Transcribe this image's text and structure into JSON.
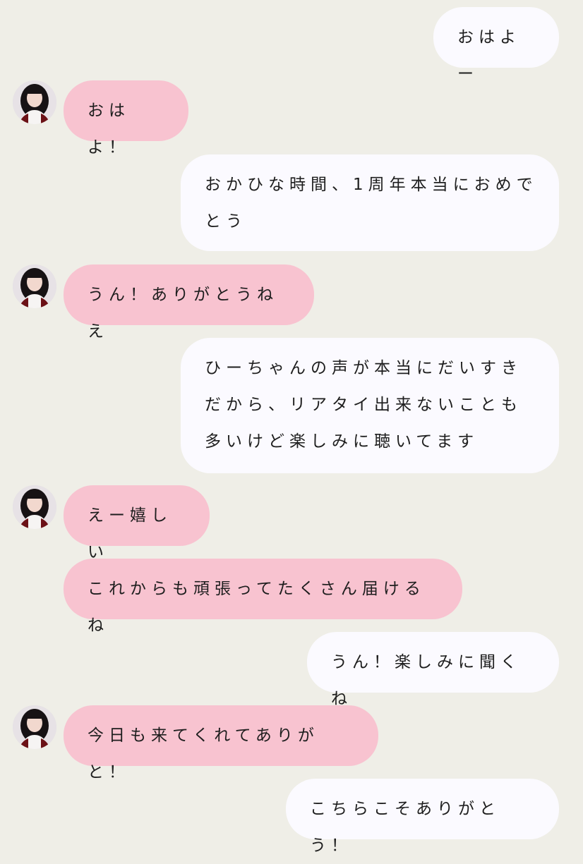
{
  "messages": [
    {
      "sender": "me",
      "text": "おはよー"
    },
    {
      "sender": "them",
      "text": "おはよ！"
    },
    {
      "sender": "me",
      "text": "おかひな時間、1周年本当におめでとう"
    },
    {
      "sender": "them",
      "text": "うん！ありがとうねえ"
    },
    {
      "sender": "me",
      "text": "ひーちゃんの声が本当にだいすきだから、リアタイ出来ないことも多いけど楽しみに聴いてます"
    },
    {
      "sender": "them",
      "text": "えー嬉しい"
    },
    {
      "sender": "them",
      "text": "これからも頑張ってたくさん届けるね"
    },
    {
      "sender": "me",
      "text": "うん！楽しみに聞くね"
    },
    {
      "sender": "them",
      "text": "今日も来てくれてありがと！"
    },
    {
      "sender": "me",
      "text": "こちらこそありがとう！"
    }
  ],
  "colors": {
    "background": "#efeee7",
    "my_bubble": "#fbfaff",
    "their_bubble": "#f8c3d0",
    "text": "#1e1e1e"
  },
  "icons": {
    "avatar": "profile-photo-avatar"
  }
}
